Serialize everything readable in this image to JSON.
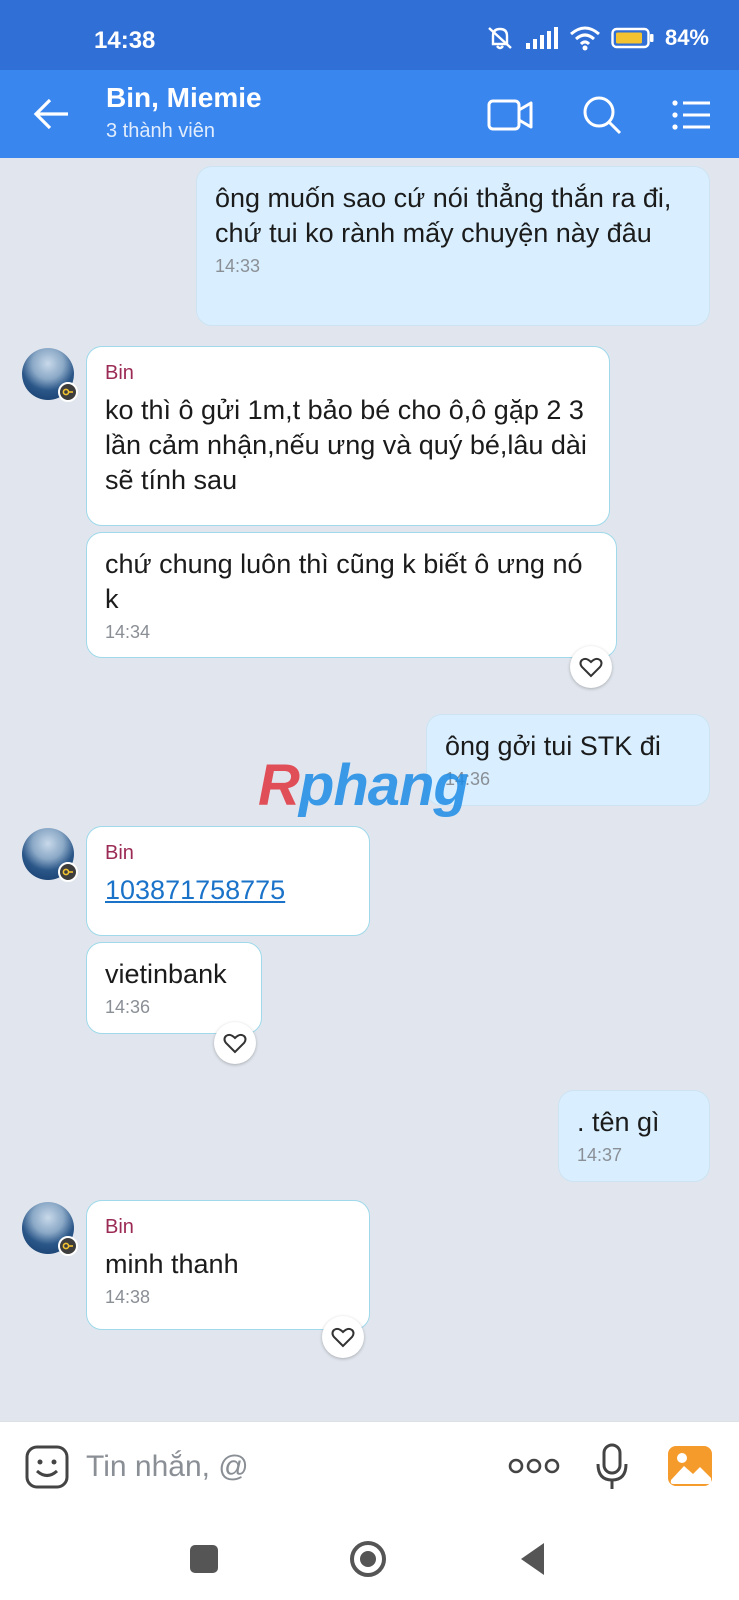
{
  "status_bar": {
    "time": "14:38",
    "battery": "84%"
  },
  "header": {
    "title": "Bin, Miemie",
    "subtitle": "3 thành viên"
  },
  "messages": [
    {
      "text": "ông muốn sao cứ nói thẳng thắn ra đi, chứ tui ko rành mấy chuyện này đâu",
      "time": "14:33"
    },
    {
      "sender": "Bin",
      "text": "ko thì ô gửi 1m,t bảo bé cho ô,ô gặp 2 3 lần cảm nhận,nếu ưng và quý bé,lâu dài sẽ tính sau"
    },
    {
      "text": "chứ chung luôn thì cũng k biết ô ưng nó k",
      "time": "14:34"
    },
    {
      "text": "ông gởi tui STK đi",
      "time": "14:36"
    },
    {
      "sender": "Bin",
      "text": "103871758775"
    },
    {
      "text": "vietinbank",
      "time": "14:36"
    },
    {
      "text": ". tên gì",
      "time": "14:37"
    },
    {
      "sender": "Bin",
      "text": "minh thanh",
      "time": "14:38"
    }
  ],
  "watermark": {
    "part1": "R",
    "part2": "phang"
  },
  "input": {
    "placeholder": "Tin nhắn, @"
  },
  "colors": {
    "header": "#3a86ef",
    "status_bar": "#2f6fd6",
    "outgoing_bubble": "#d9efff",
    "sender_name": "#9b2a55",
    "link": "#1a73c9"
  }
}
